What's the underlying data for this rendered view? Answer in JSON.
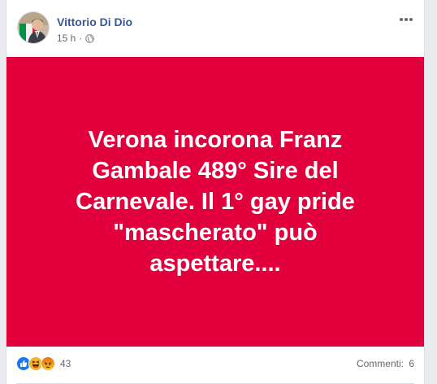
{
  "post": {
    "author_name": "Vittorio Di Dio",
    "timestamp": "15 h",
    "separator": "·",
    "privacy_icon": "globe-icon",
    "body_text": "Verona incorona Franz Gambale 489° Sire del Carnevale. Il 1° gay pride \"mascherato\" può aspettare....",
    "background_color": "#e2003c"
  },
  "footer": {
    "reaction_icons": [
      "like-icon",
      "haha-icon",
      "angry-icon"
    ],
    "reaction_count": "43",
    "comments_label": "Commenti:",
    "comments_count": "6"
  },
  "colors": {
    "author_link": "#385898",
    "meta_text": "#616770",
    "like_blue": "#1877f2",
    "haha_yellow": "#f7b125",
    "angry_orange": "#e9710f"
  }
}
